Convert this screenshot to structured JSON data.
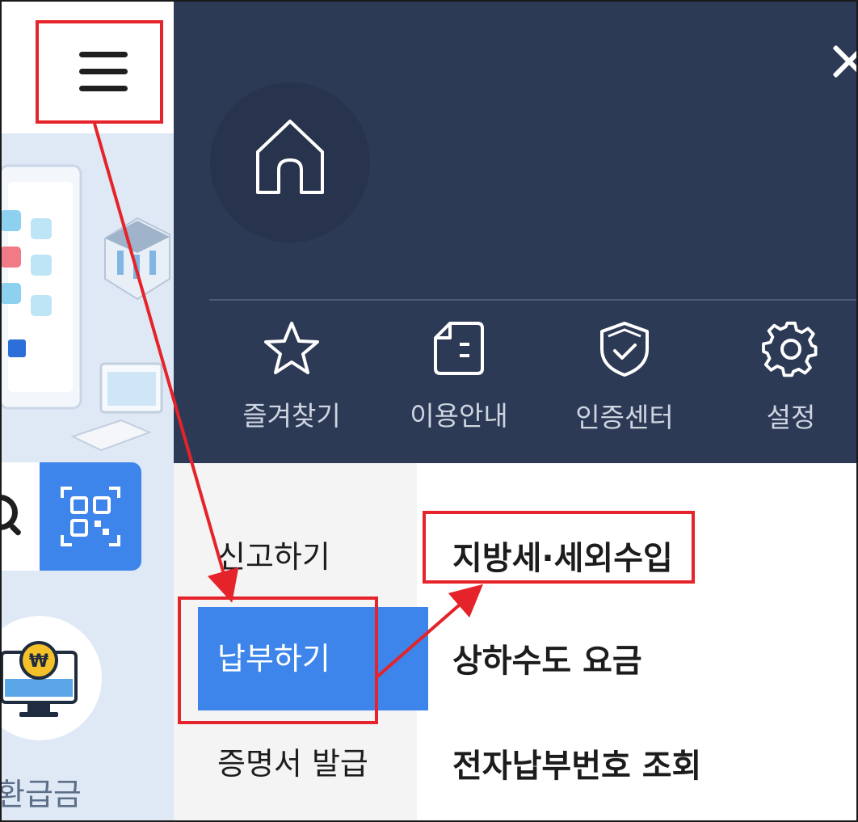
{
  "background_app": {
    "search_icon": "search-icon",
    "qr_icon": "qr-scan-icon",
    "menu_icon": "hamburger-icon",
    "refund_label": "환급금"
  },
  "drawer": {
    "home_icon": "home-icon",
    "close_icon": "close-icon",
    "quick_links": [
      {
        "label": "즐겨찾기",
        "icon": "star-icon"
      },
      {
        "label": "이용안내",
        "icon": "document-icon"
      },
      {
        "label": "인증센터",
        "icon": "shield-check-icon"
      },
      {
        "label": "설정",
        "icon": "gear-icon"
      }
    ],
    "categories": [
      "신고하기",
      "납부하기",
      "증명서 발급"
    ],
    "active_category": "납부하기",
    "sub_items": [
      "지방세·세외수입",
      "상하수도 요금",
      "전자납부번호 조회"
    ]
  },
  "colors": {
    "drawer_header": "#2d3a55",
    "accent_blue": "#3d85ea",
    "annotation_red": "#e5232a",
    "left_bg": "#dfe9f6"
  }
}
